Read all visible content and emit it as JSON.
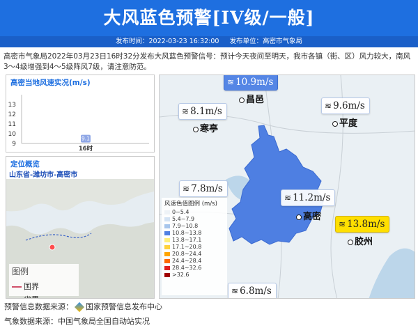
{
  "header": {
    "title": "大风蓝色预警[IV级/一般]"
  },
  "subbar": {
    "publish_time": "发布时间：2022-03-23 16:32:00",
    "publisher": "发布单位：高密市气象局"
  },
  "description": "高密市气象局2022年03月23日16时32分发布大风蓝色预警信号：预计今天夜间至明天，我市各镇（街、区）风力较大，南风3～4级增强到4～5级阵风7级，请注意防范。",
  "wind_panel": {
    "title": "高密当地风速实况(m/s)",
    "chart_data": {
      "type": "bar",
      "categories": [
        "16时"
      ],
      "values": [
        9.1
      ],
      "yticks": [
        13,
        12,
        11,
        10,
        9
      ],
      "ylim": [
        9,
        13
      ]
    }
  },
  "location_panel": {
    "title": "定位概览",
    "region": "山东省-潍坊市-高密市",
    "legend_title": "图例",
    "legend_items": [
      {
        "label": "国界",
        "color": "#d0506a"
      },
      {
        "label": "省界",
        "color": "#3a63c8"
      }
    ]
  },
  "map": {
    "wind_labels": [
      {
        "value": "10.9m/s",
        "style": "blue"
      },
      {
        "value": "8.1m/s",
        "style": "white"
      },
      {
        "value": "9.6m/s",
        "style": "white"
      },
      {
        "value": "7.8m/s",
        "style": "white"
      },
      {
        "value": "11.2m/s",
        "style": "white"
      },
      {
        "value": "13.8m/s",
        "style": "yellow"
      },
      {
        "value": "6.8m/s",
        "style": "white"
      }
    ],
    "cities": [
      "昌邑",
      "寒亭",
      "平度",
      "高密",
      "胶州"
    ],
    "legend": {
      "title": "风速色值图例 (m/s)",
      "items": [
        {
          "label": "0~5.4",
          "color": "#eef3f7"
        },
        {
          "label": "5.4~7.9",
          "color": "#d3e3f4"
        },
        {
          "label": "7.9~10.8",
          "color": "#a7c6ec"
        },
        {
          "label": "10.8~13.8",
          "color": "#4e7fe2"
        },
        {
          "label": "13.8~17.1",
          "color": "#ffee7a"
        },
        {
          "label": "17.1~20.8",
          "color": "#ffd23c"
        },
        {
          "label": "20.8~24.4",
          "color": "#ffa500"
        },
        {
          "label": "24.4~28.4",
          "color": "#ff6a00"
        },
        {
          "label": "28.4~32.6",
          "color": "#e02020"
        },
        {
          "label": ">32.6",
          "color": "#a00000"
        }
      ]
    }
  },
  "footer": {
    "source1": "预警信息数据来源：",
    "source1_name": "国家预警信息发布中心",
    "source2": "气象数据来源：中国气象局全国自动站实况"
  }
}
